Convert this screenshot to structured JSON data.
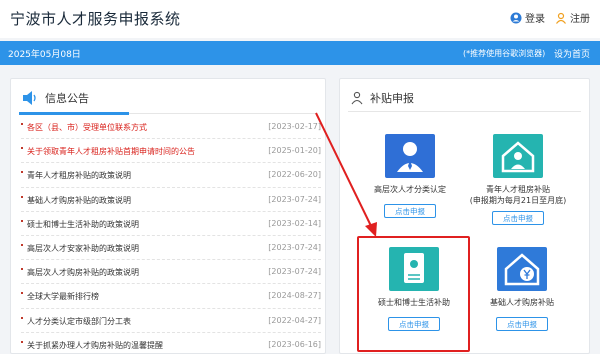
{
  "header": {
    "title": "宁波市人才服务申报系统",
    "login": "登录",
    "register": "注册"
  },
  "bar": {
    "date": "2025年05月08日",
    "tip": "(*推荐使用谷歌浏览器)",
    "home": "设为首页"
  },
  "notice": {
    "title": "信息公告",
    "items": [
      {
        "title": "各区（县、市）受理单位联系方式",
        "date": "[2023-02-17]",
        "red": true
      },
      {
        "title": "关于领取青年人才租房补贴首期申请时间的公告",
        "date": "[2025-01-20]",
        "red": true
      },
      {
        "title": "青年人才租房补贴的政策说明",
        "date": "[2022-06-20]",
        "red": false
      },
      {
        "title": "基础人才购房补贴的政策说明",
        "date": "[2023-07-24]",
        "red": false
      },
      {
        "title": "硕士和博士生活补助的政策说明",
        "date": "[2023-02-14]",
        "red": false
      },
      {
        "title": "高层次人才安家补助的政策说明",
        "date": "[2023-07-24]",
        "red": false
      },
      {
        "title": "高层次人才购房补贴的政策说明",
        "date": "[2023-07-24]",
        "red": false
      },
      {
        "title": "全球大学最新排行榜",
        "date": "[2024-08-27]",
        "red": false
      },
      {
        "title": "人才分类认定市级部门分工表",
        "date": "[2022-04-27]",
        "red": false
      },
      {
        "title": "关于抓紧办理人才购房补贴的温馨提醒",
        "date": "[2023-06-16]",
        "red": false
      }
    ]
  },
  "subsidy": {
    "title": "补贴申报",
    "cards": [
      {
        "label": "高层次人才分类认定",
        "label2": "",
        "btn": "点击申报",
        "color": "#2f6fd6",
        "icon": "person-icon"
      },
      {
        "label": "青年人才租房补贴",
        "label2": "(申报期为每月21日至月底)",
        "btn": "点击申报",
        "color": "#25b4b0",
        "icon": "house-person-icon"
      },
      {
        "label": "硕士和博士生活补助",
        "label2": "",
        "btn": "点击申报",
        "color": "#25b4b0",
        "icon": "certificate-icon"
      },
      {
        "label": "基础人才购房补贴",
        "label2": "",
        "btn": "点击申报",
        "color": "#2f7ad9",
        "icon": "house-yen-icon"
      }
    ]
  },
  "colors": {
    "accent": "#2d93e8",
    "highlight": "#e02020",
    "red_text": "#d9221c"
  }
}
